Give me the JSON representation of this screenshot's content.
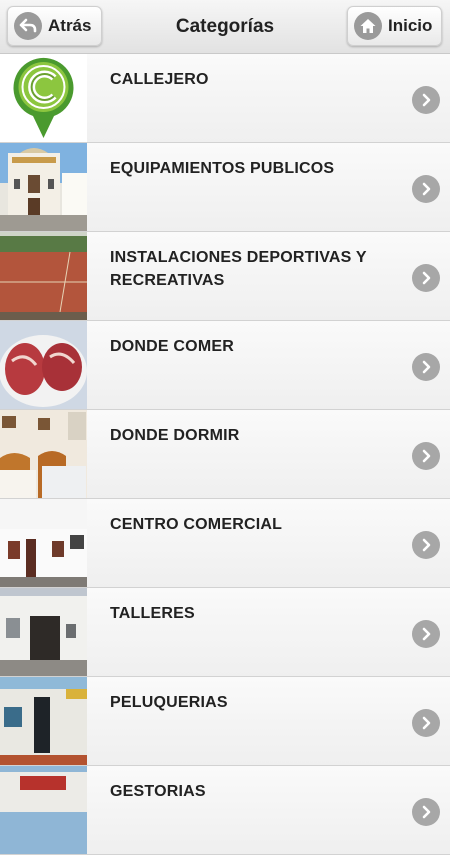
{
  "header": {
    "back_label": "Atrás",
    "title": "Categorías",
    "home_label": "Inicio"
  },
  "categories": [
    {
      "label": "CALLEJERO"
    },
    {
      "label": "EQUIPAMIENTOS PUBLICOS"
    },
    {
      "label": "INSTALACIONES DEPORTIVAS Y RECREATIVAS"
    },
    {
      "label": "DONDE COMER"
    },
    {
      "label": "DONDE DORMIR"
    },
    {
      "label": "CENTRO COMERCIAL"
    },
    {
      "label": "TALLERES"
    },
    {
      "label": "PELUQUERIAS"
    },
    {
      "label": "GESTORIAS"
    }
  ],
  "icons": {
    "back": "arrow-left-circle-icon",
    "home": "house-icon",
    "row_chevron": "chevron-right-circle-icon"
  }
}
